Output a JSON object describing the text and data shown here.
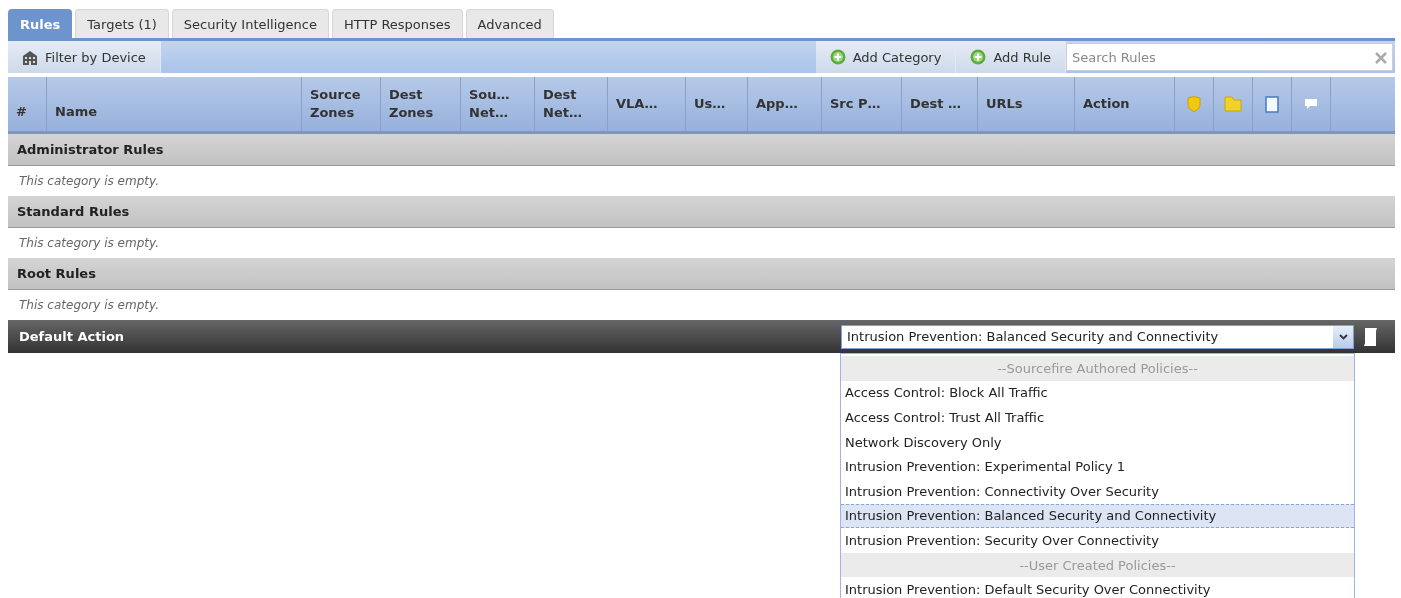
{
  "tabs": [
    {
      "label": "Rules",
      "selected": true
    },
    {
      "label": "Targets (1)",
      "selected": false
    },
    {
      "label": "Security Intelligence",
      "selected": false
    },
    {
      "label": "HTTP Responses",
      "selected": false
    },
    {
      "label": "Advanced",
      "selected": false
    }
  ],
  "toolbar": {
    "filter_button": "Filter by Device",
    "buttons": [
      "Add Category",
      "Add Rule"
    ],
    "search": {
      "placeholder": "Search Rules"
    }
  },
  "table": {
    "columns": [
      "#",
      "Name",
      "Source Zones",
      "Dest Zones",
      "Sou… Net…",
      "Dest Net…",
      "VLA…",
      "Us…",
      "App…",
      "Src P…",
      "Dest …",
      "URLs",
      "Action"
    ],
    "categories": [
      {
        "name": "Administrator Rules",
        "empty_text": "This category is empty."
      },
      {
        "name": "Standard Rules",
        "empty_text": "This category is empty."
      },
      {
        "name": "Root Rules",
        "empty_text": "This category is empty."
      }
    ]
  },
  "default_action": {
    "label": "Default Action",
    "value": "Intrusion Prevention: Balanced Security and Connectivity",
    "options": [
      {
        "kind": "group",
        "label": "--Sourcefire Authored Policies--"
      },
      {
        "kind": "option",
        "label": "Access Control: Block All Traffic",
        "selected": false
      },
      {
        "kind": "option",
        "label": "Access Control: Trust All Traffic",
        "selected": false
      },
      {
        "kind": "option",
        "label": "Network Discovery Only",
        "selected": false
      },
      {
        "kind": "option",
        "label": "Intrusion Prevention: Experimental Policy 1",
        "selected": false
      },
      {
        "kind": "option",
        "label": "Intrusion Prevention: Connectivity Over Security",
        "selected": false
      },
      {
        "kind": "option",
        "label": "Intrusion Prevention: Balanced Security and Connectivity",
        "selected": true
      },
      {
        "kind": "option",
        "label": "Intrusion Prevention: Security Over Connectivity",
        "selected": false
      },
      {
        "kind": "group",
        "label": "--User Created Policies--"
      },
      {
        "kind": "option",
        "label": "Intrusion Prevention: Default Security Over Connectivity",
        "selected": false
      }
    ]
  }
}
